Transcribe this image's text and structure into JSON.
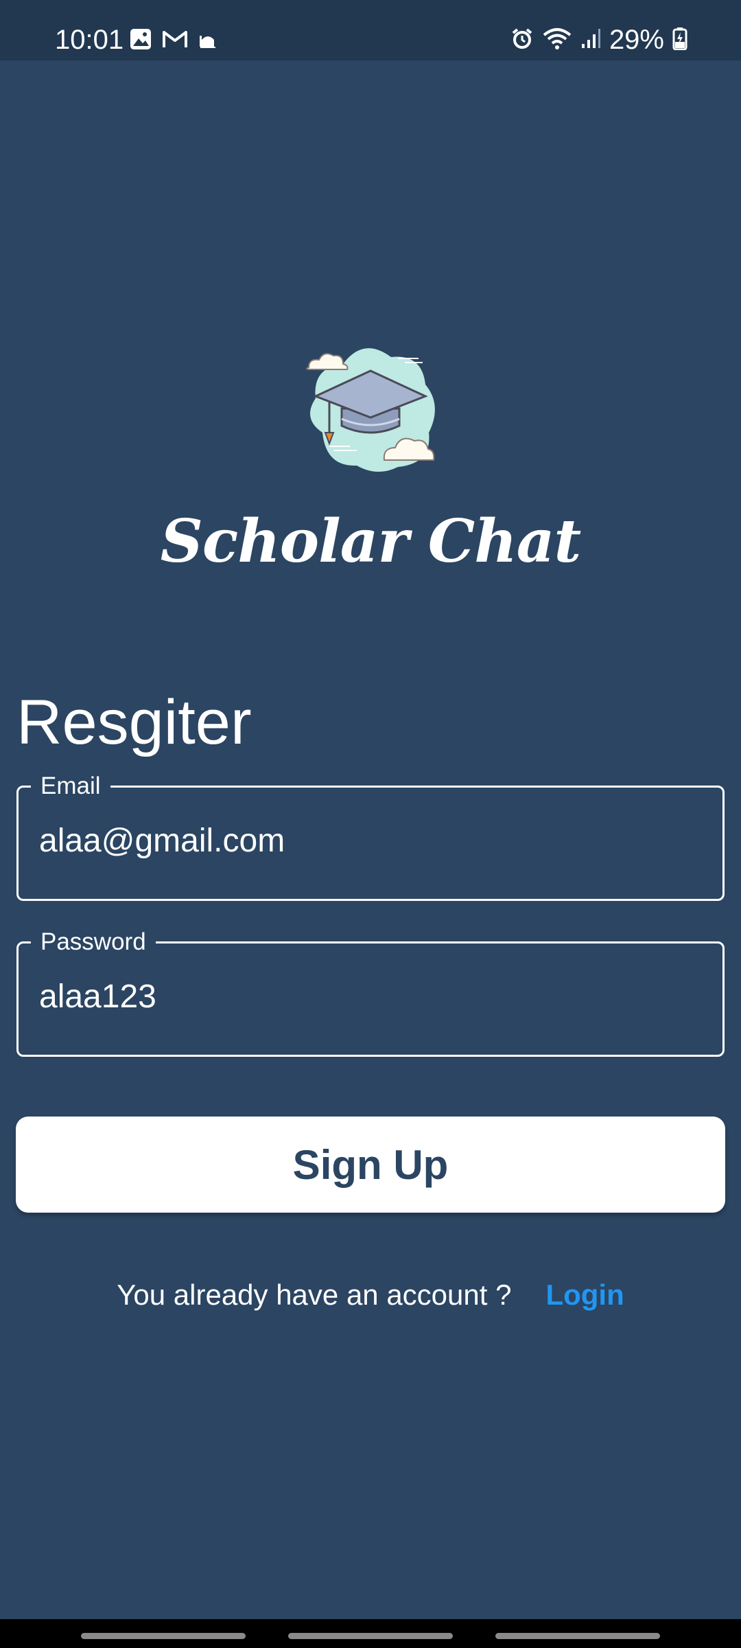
{
  "status_bar": {
    "time": "10:01",
    "battery": "29%",
    "left_icons": [
      "gallery-icon",
      "gmail-icon",
      "mosque-icon"
    ],
    "right_icons": [
      "alarm-icon",
      "wifi-icon",
      "signal-icon",
      "battery-charging-icon"
    ]
  },
  "app": {
    "title": "Scholar Chat",
    "logo_icon": "graduation-cap-icon"
  },
  "form": {
    "heading": "Resgiter",
    "email": {
      "label": "Email",
      "value": "alaa@gmail.com"
    },
    "password": {
      "label": "Password",
      "value": "alaa123"
    },
    "submit_label": "Sign Up"
  },
  "footer": {
    "prompt": "You already have an account ?",
    "login_label": "Login"
  },
  "colors": {
    "background": "#2b4562",
    "status_bar": "#223850",
    "link": "#2196f3",
    "button_bg": "#ffffff",
    "button_text": "#2b4562"
  }
}
